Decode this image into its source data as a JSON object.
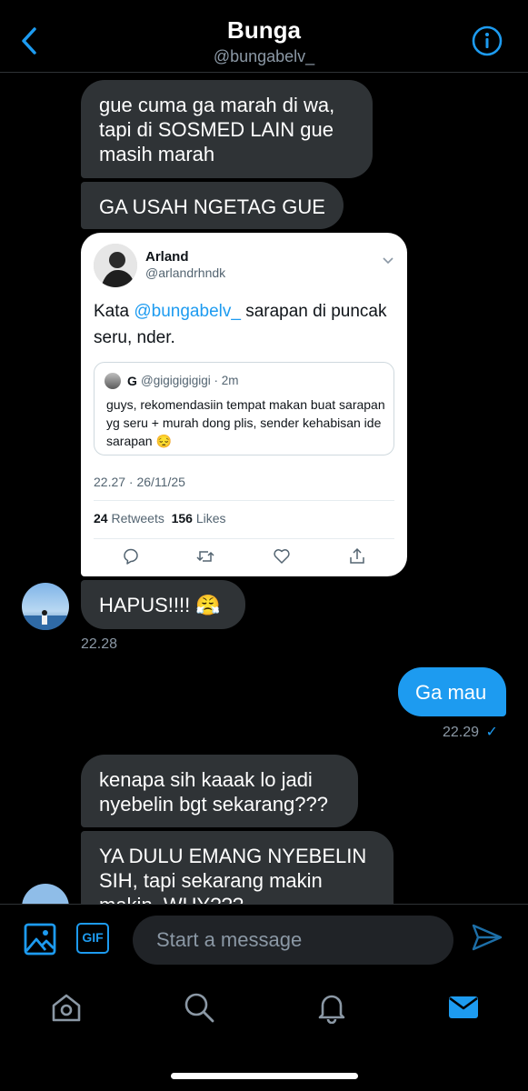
{
  "header": {
    "name": "Bunga",
    "handle": "@bungabelv_"
  },
  "messages": {
    "m1_lines": [
      "gue cuma ga marah di wa,",
      "tapi di SOSMED LAIN gue",
      "masih marah"
    ],
    "m2": "GA USAH NGETAG GUE",
    "m3": "HAPUS!!!! 😤",
    "m3_time": "22.28",
    "m4": "Ga mau",
    "m4_time": "22.29",
    "m4_status": "✓",
    "m5_lines": [
      "kenapa sih kaaak lo jadi",
      "nyebelin bgt sekarang???"
    ],
    "m6_lines": [
      "YA DULU EMANG NYEBELIN",
      "SIH, tapi sekarang makin",
      "makin. WHY???"
    ]
  },
  "tweet": {
    "name": "Arland",
    "handle": "@arlandrhndk",
    "text_before": "Kata ",
    "mention": "@bungabelv_",
    "text_after": " sarapan di puncak seru, nder.",
    "quote": {
      "name": "G",
      "handle": "@gigigigigigi · 2m",
      "text": "guys, rekomendasiin tempat makan buat sarapan yg seru + murah dong plis, sender kehabisan ide sarapan 😔"
    },
    "timestamp": "22.27 · 26/11/25",
    "retweets_count": "24",
    "retweets_label": "Retweets",
    "likes_count": "156",
    "likes_label": "Likes"
  },
  "composer": {
    "placeholder": "Start a message",
    "gif_label": "GIF"
  },
  "colors": {
    "accent": "#1d9bf0",
    "incoming_bubble": "#2f3336",
    "background": "#000000"
  },
  "icons": [
    "back-arrow-icon",
    "info-icon",
    "image-icon",
    "send-icon",
    "home-icon",
    "search-icon",
    "bell-icon",
    "mail-icon",
    "reply-icon",
    "retweet-icon",
    "like-icon",
    "share-icon"
  ]
}
